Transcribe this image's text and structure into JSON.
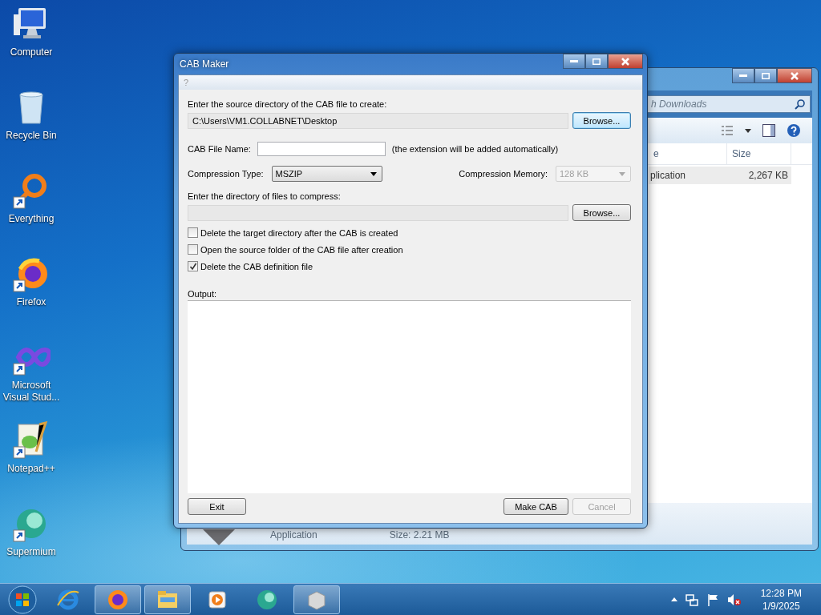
{
  "desktop_icons": [
    {
      "label": "Computer",
      "shortcut": false
    },
    {
      "label": "Recycle Bin",
      "shortcut": false
    },
    {
      "label": "Everything",
      "shortcut": true
    },
    {
      "label": "Firefox",
      "shortcut": true
    },
    {
      "label": "Microsoft Visual Stud...",
      "shortcut": true
    },
    {
      "label": "Notepad++",
      "shortcut": true
    },
    {
      "label": "Supermium",
      "shortcut": true
    }
  ],
  "explorer_window": {
    "search": {
      "placeholder": "h Downloads"
    },
    "columns": [
      "e",
      "Size"
    ],
    "rows": [
      {
        "type": "plication",
        "size": "2,267 KB",
        "selected": true
      }
    ],
    "details": {
      "type": "Application",
      "size": "Size: 2.21 MB"
    }
  },
  "dialog": {
    "title": "CAB Maker",
    "menu": [
      "?"
    ],
    "source": {
      "label": "Enter the source directory of the CAB file to create:",
      "value": "C:\\Users\\VM1.COLLABNET\\Desktop",
      "button": {
        "label": "Browse...",
        "focused": true
      }
    },
    "file_name": {
      "label": "CAB File Name:",
      "note": "(the extension will be added automatically)"
    },
    "compression_type": {
      "label": "Compression Type:",
      "value": "MSZIP",
      "disabled": false
    },
    "compression_memory": {
      "label": "Compression Memory:",
      "value": "128 KB",
      "disabled": true
    },
    "files_dir": {
      "label": "Enter the directory of files to compress:",
      "button": {
        "label": "Browse...",
        "focused": false
      }
    },
    "options": [
      {
        "label": "Delete the target directory after the CAB is created",
        "checked": false
      },
      {
        "label": "Open the source folder of the CAB file after creation",
        "checked": false
      },
      {
        "label": "Delete the CAB definition file",
        "checked": true
      }
    ],
    "output": {
      "label": "Output:"
    },
    "buttons": [
      {
        "label": "Exit",
        "disabled": false
      },
      {
        "label": "Make CAB",
        "disabled": false
      },
      {
        "label": "Cancel",
        "disabled": true
      }
    ]
  },
  "taskbar": {
    "apps": [
      {
        "running": false
      },
      {
        "running": true
      },
      {
        "running": true
      },
      {
        "running": false
      },
      {
        "running": false
      },
      {
        "running": true
      }
    ],
    "clock": {
      "time": "12:28 PM",
      "date": "1/9/2025"
    }
  }
}
